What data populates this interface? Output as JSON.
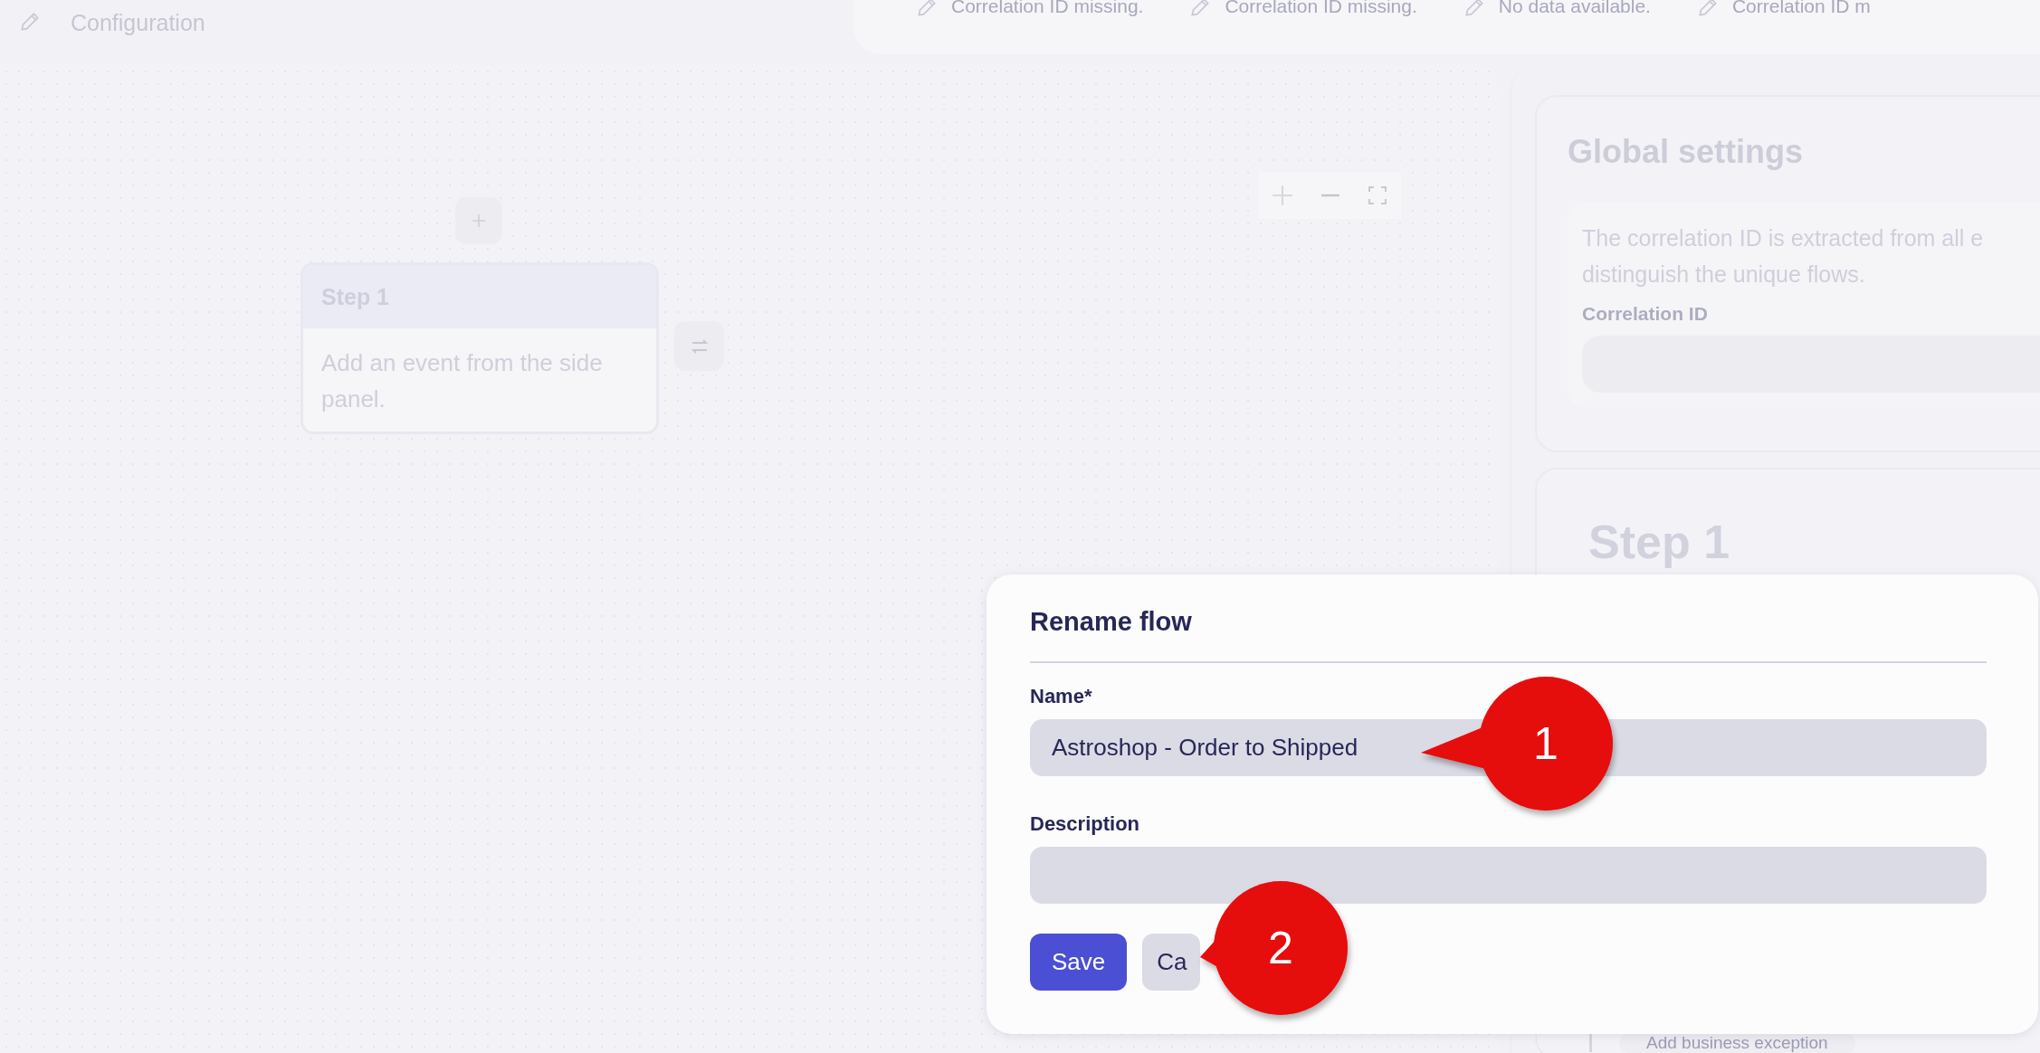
{
  "header": {
    "title": "Configuration"
  },
  "status_items": [
    {
      "text": "Correlation ID missing."
    },
    {
      "text": "Correlation ID missing."
    },
    {
      "text": "No data available."
    },
    {
      "text": "Correlation ID m"
    }
  ],
  "canvas": {
    "step": {
      "title": "Step 1",
      "body": "Add an event from the side panel."
    }
  },
  "side_panel": {
    "global_settings": {
      "title": "Global settings",
      "description": "The correlation ID is extracted from all e",
      "description_2": "distinguish the unique flows.",
      "field_label": "Correlation ID"
    },
    "step_title": "Step 1",
    "exception_link": "Add business exception"
  },
  "dialog": {
    "title": "Rename flow",
    "fields": [
      {
        "label": "Name*",
        "value": "Astroshop - Order to Shipped"
      },
      {
        "label": "Description"
      }
    ],
    "buttons": [
      {
        "label": "Save",
        "kind": "primary"
      },
      {
        "label": "Ca",
        "kind": "secondary"
      }
    ]
  },
  "callouts": [
    {
      "number": "1"
    },
    {
      "number": "2"
    }
  ]
}
